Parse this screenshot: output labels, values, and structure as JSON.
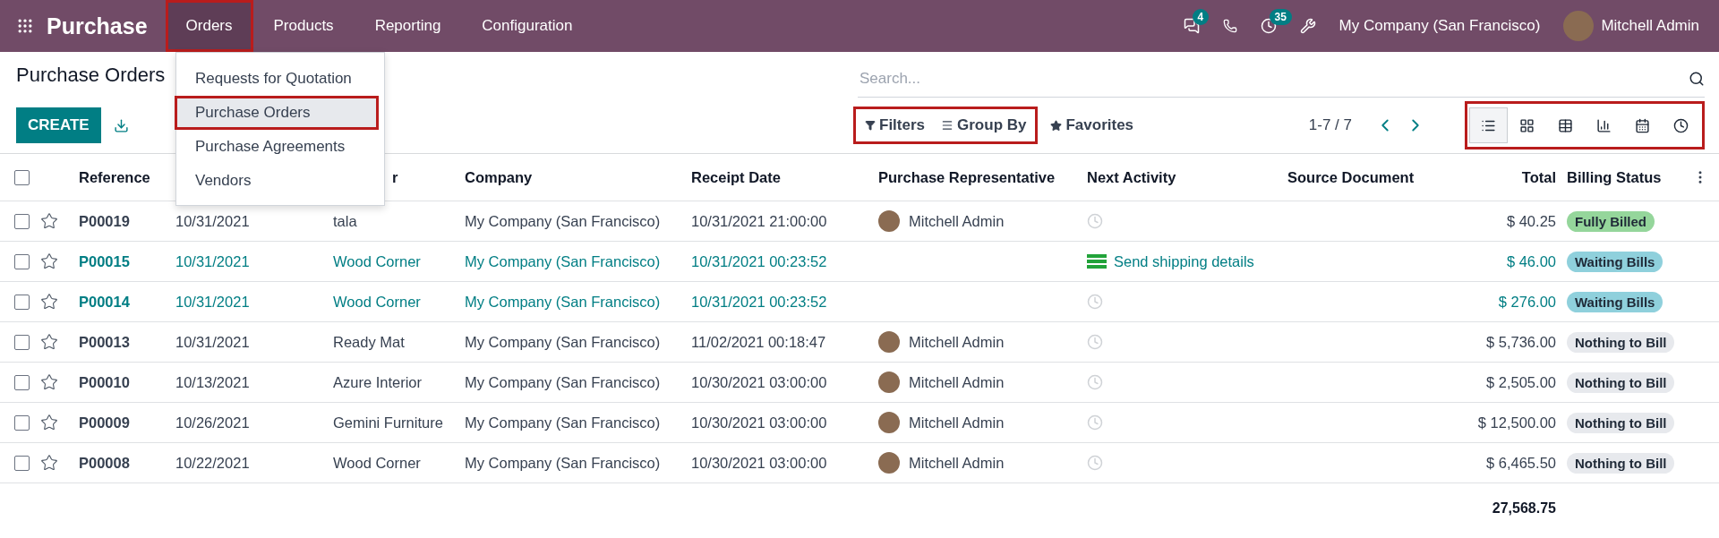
{
  "navbar": {
    "brand": "Purchase",
    "menu": [
      {
        "label": "Orders",
        "selected": true,
        "highlighted": true
      },
      {
        "label": "Products",
        "selected": false,
        "highlighted": false
      },
      {
        "label": "Reporting",
        "selected": false,
        "highlighted": false
      },
      {
        "label": "Configuration",
        "selected": false,
        "highlighted": false
      }
    ],
    "messages_badge": "4",
    "activities_badge": "35",
    "company": "My Company (San Francisco)",
    "user": "Mitchell Admin"
  },
  "dropdown": {
    "items": [
      {
        "label": "Requests for Quotation",
        "selected": false,
        "highlighted": false
      },
      {
        "label": "Purchase Orders",
        "selected": true,
        "highlighted": true
      },
      {
        "label": "Purchase Agreements",
        "selected": false,
        "highlighted": false
      },
      {
        "label": "Vendors",
        "selected": false,
        "highlighted": false
      }
    ]
  },
  "control_panel": {
    "title": "Purchase Orders",
    "create_button": "CREATE",
    "search": {
      "placeholder": "Search..."
    },
    "filter_group": {
      "highlighted": true,
      "items": [
        {
          "kind": "filter",
          "label": "Filters"
        },
        {
          "kind": "group",
          "label": "Group By"
        }
      ]
    },
    "favorites": "Favorites",
    "pager": "1-7 / 7",
    "views_highlighted": true,
    "views": [
      {
        "kind": "list",
        "selected": true
      },
      {
        "kind": "kanban",
        "selected": false
      },
      {
        "kind": "pivot",
        "selected": false
      },
      {
        "kind": "graph",
        "selected": false
      },
      {
        "kind": "calendar",
        "selected": false
      },
      {
        "kind": "activity",
        "selected": false
      }
    ]
  },
  "table": {
    "select_all_checked": false,
    "columns": [
      {
        "label": "Reference"
      },
      {},
      {
        "label": "r"
      },
      {
        "label": "Company"
      },
      {
        "label": "Receipt Date"
      },
      {
        "label": "Purchase Representative"
      },
      {
        "label": "Next Activity"
      },
      {
        "label": "Source Document"
      },
      {
        "label": "Total"
      },
      {
        "label": "Billing Status"
      }
    ],
    "rows": [
      {
        "checked": false,
        "accent": false,
        "reference": "P00019",
        "order_date": "10/31/2021",
        "vendor": "tala",
        "company": "My Company (San Francisco)",
        "receipt_date": "10/31/2021 21:00:00",
        "representative": "Mitchell Admin",
        "activity": {
          "kind": "none"
        },
        "total": "$ 40.25",
        "billing": {
          "label": "Fully Billed",
          "color": "#95d69b"
        }
      },
      {
        "checked": false,
        "accent": true,
        "reference": "P00015",
        "order_date": "10/31/2021",
        "vendor": "Wood Corner",
        "company": "My Company (San Francisco)",
        "receipt_date": "10/31/2021 00:23:52",
        "activity": {
          "kind": "todo",
          "label": "Send shipping details"
        },
        "total": "$ 46.00",
        "billing": {
          "label": "Waiting Bills",
          "color": "#8fd0dc"
        }
      },
      {
        "checked": false,
        "accent": true,
        "reference": "P00014",
        "order_date": "10/31/2021",
        "vendor": "Wood Corner",
        "company": "My Company (San Francisco)",
        "receipt_date": "10/31/2021 00:23:52",
        "activity": {
          "kind": "none"
        },
        "total": "$ 276.00",
        "billing": {
          "label": "Waiting Bills",
          "color": "#8fd0dc"
        }
      },
      {
        "checked": false,
        "accent": false,
        "reference": "P00013",
        "order_date": "10/31/2021",
        "vendor": "Ready Mat",
        "company": "My Company (San Francisco)",
        "receipt_date": "11/02/2021 00:18:47",
        "representative": "Mitchell Admin",
        "activity": {
          "kind": "none"
        },
        "total": "$ 5,736.00",
        "billing": {
          "label": "Nothing to Bill",
          "color": "#e7e9ed"
        }
      },
      {
        "checked": false,
        "accent": false,
        "reference": "P00010",
        "order_date": "10/13/2021",
        "vendor": "Azure Interior",
        "company": "My Company (San Francisco)",
        "receipt_date": "10/30/2021 03:00:00",
        "representative": "Mitchell Admin",
        "activity": {
          "kind": "none"
        },
        "total": "$ 2,505.00",
        "billing": {
          "label": "Nothing to Bill",
          "color": "#e7e9ed"
        }
      },
      {
        "checked": false,
        "accent": false,
        "reference": "P00009",
        "order_date": "10/26/2021",
        "vendor": "Gemini Furniture",
        "company": "My Company (San Francisco)",
        "receipt_date": "10/30/2021 03:00:00",
        "representative": "Mitchell Admin",
        "activity": {
          "kind": "none"
        },
        "total": "$ 12,500.00",
        "billing": {
          "label": "Nothing to Bill",
          "color": "#e7e9ed"
        }
      },
      {
        "checked": false,
        "accent": false,
        "reference": "P00008",
        "order_date": "10/22/2021",
        "vendor": "Wood Corner",
        "company": "My Company (San Francisco)",
        "receipt_date": "10/30/2021 03:00:00",
        "representative": "Mitchell Admin",
        "activity": {
          "kind": "none"
        },
        "total": "$ 6,465.50",
        "billing": {
          "label": "Nothing to Bill",
          "color": "#e7e9ed"
        }
      }
    ],
    "sum": "27,568.75"
  }
}
